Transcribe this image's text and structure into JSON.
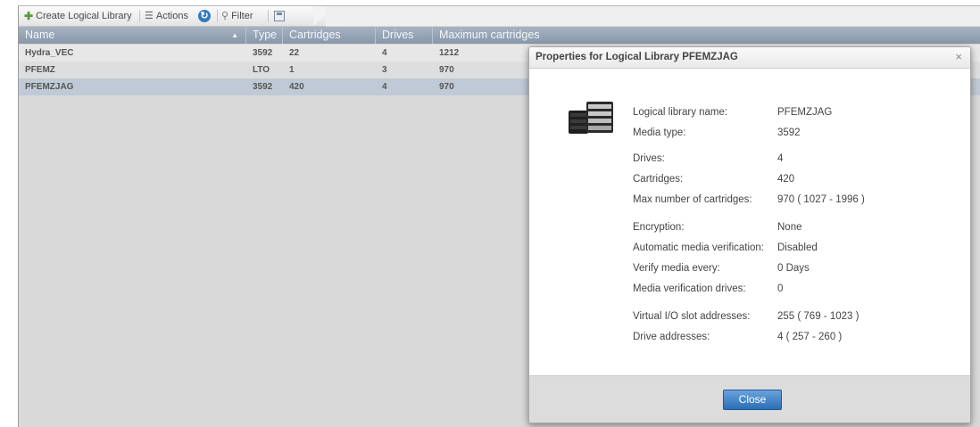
{
  "toolbar": {
    "create_label": "Create Logical Library",
    "actions_label": "Actions",
    "filter_label": "Filter"
  },
  "icons": {
    "create": "plus-icon",
    "actions": "list-icon",
    "refresh": "refresh-icon",
    "filter": "search-icon",
    "save": "save-icon",
    "close": "close-icon",
    "library": "tape-library-icon"
  },
  "table": {
    "columns": [
      "Name",
      "Type",
      "Cartridges",
      "Drives",
      "Maximum cartridges"
    ],
    "sort_column": "Name",
    "sort_direction": "ascending",
    "rows": [
      {
        "name": "Hydra_VEC",
        "type": "3592",
        "cartridges": "22",
        "drives": "4",
        "max": "1212"
      },
      {
        "name": "PFEMZ",
        "type": "LTO",
        "cartridges": "1",
        "drives": "3",
        "max": "970"
      },
      {
        "name": "PFEMZJAG",
        "type": "3592",
        "cartridges": "420",
        "drives": "4",
        "max": "970"
      }
    ],
    "selected_row": "PFEMZJAG"
  },
  "dialog": {
    "title": "Properties for Logical Library PFEMZJAG",
    "close_symbol": "×",
    "properties": [
      {
        "label": "Logical library name:",
        "value": "PFEMZJAG"
      },
      {
        "label": "Media type:",
        "value": "3592"
      },
      {
        "label": "Drives:",
        "value": "4"
      },
      {
        "label": "Cartridges:",
        "value": "420"
      },
      {
        "label": "Max number of cartridges:",
        "value": "970 ( 1027 - 1996 )"
      },
      {
        "label": "Encryption:",
        "value": "None"
      },
      {
        "label": "Automatic media verification:",
        "value": "Disabled"
      },
      {
        "label": "Verify media every:",
        "value": "0 Days"
      },
      {
        "label": "Media verification drives:",
        "value": "0"
      },
      {
        "label": "Virtual I/O slot addresses:",
        "value": "255 ( 769 - 1023 )"
      },
      {
        "label": "Drive addresses:",
        "value": "4 ( 257 - 260 )"
      }
    ],
    "close_button_label": "Close"
  },
  "colors": {
    "header_bg": "#8f9fb2",
    "selected_row": "#bfcad6",
    "close_button": "#2b6eb6",
    "refresh_icon": "#2f7bbd"
  }
}
